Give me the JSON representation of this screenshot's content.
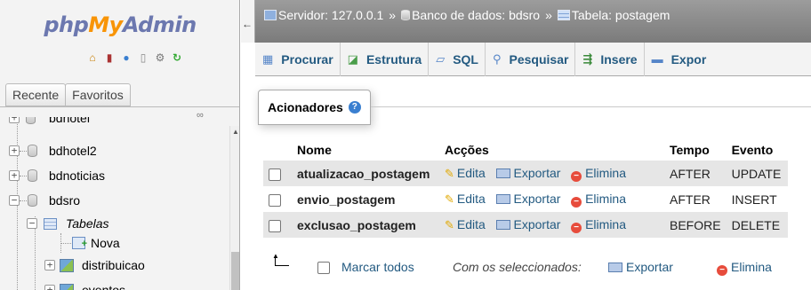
{
  "logo": {
    "part1": "php",
    "part2": "My",
    "part3": "Admin"
  },
  "nav_icons": [
    "home-icon",
    "exit-icon",
    "help-icon",
    "docs-icon",
    "settings-icon",
    "reload-icon"
  ],
  "left_tabs": [
    "Recente",
    "Favoritos"
  ],
  "tree": {
    "items": [
      {
        "label": "bdhotel"
      },
      {
        "label": "bdhotel2"
      },
      {
        "label": "bdnoticias"
      },
      {
        "label": "bdsro"
      },
      {
        "label": "Tabelas"
      },
      {
        "label": "Nova"
      },
      {
        "label": "distribuicao"
      },
      {
        "label": "eventos"
      }
    ]
  },
  "breadcrumb": {
    "server": "Servidor: 127.0.0.1",
    "sep1": "»",
    "database": "Banco de dados: bdsro",
    "sep2": "»",
    "table": "Tabela: postagem"
  },
  "menubar": {
    "items": [
      "Procurar",
      "Estrutura",
      "SQL",
      "Pesquisar",
      "Insere",
      "Expor"
    ]
  },
  "triggers": {
    "legend": "Acionadores",
    "headers": {
      "name": "Nome",
      "actions": "Acções",
      "time": "Tempo",
      "event": "Evento"
    },
    "rows": [
      {
        "name": "atualizacao_postagem",
        "edit": "Edita",
        "export": "Exportar",
        "delete": "Elimina",
        "time": "AFTER",
        "event": "UPDATE"
      },
      {
        "name": "envio_postagem",
        "edit": "Edita",
        "export": "Exportar",
        "delete": "Elimina",
        "time": "AFTER",
        "event": "INSERT"
      },
      {
        "name": "exclusao_postagem",
        "edit": "Edita",
        "export": "Exportar",
        "delete": "Elimina",
        "time": "BEFORE",
        "event": "DELETE"
      }
    ]
  },
  "bulk": {
    "check_all": "Marcar todos",
    "with_selected": "Com os seleccionados:",
    "export": "Exportar",
    "delete": "Elimina"
  }
}
